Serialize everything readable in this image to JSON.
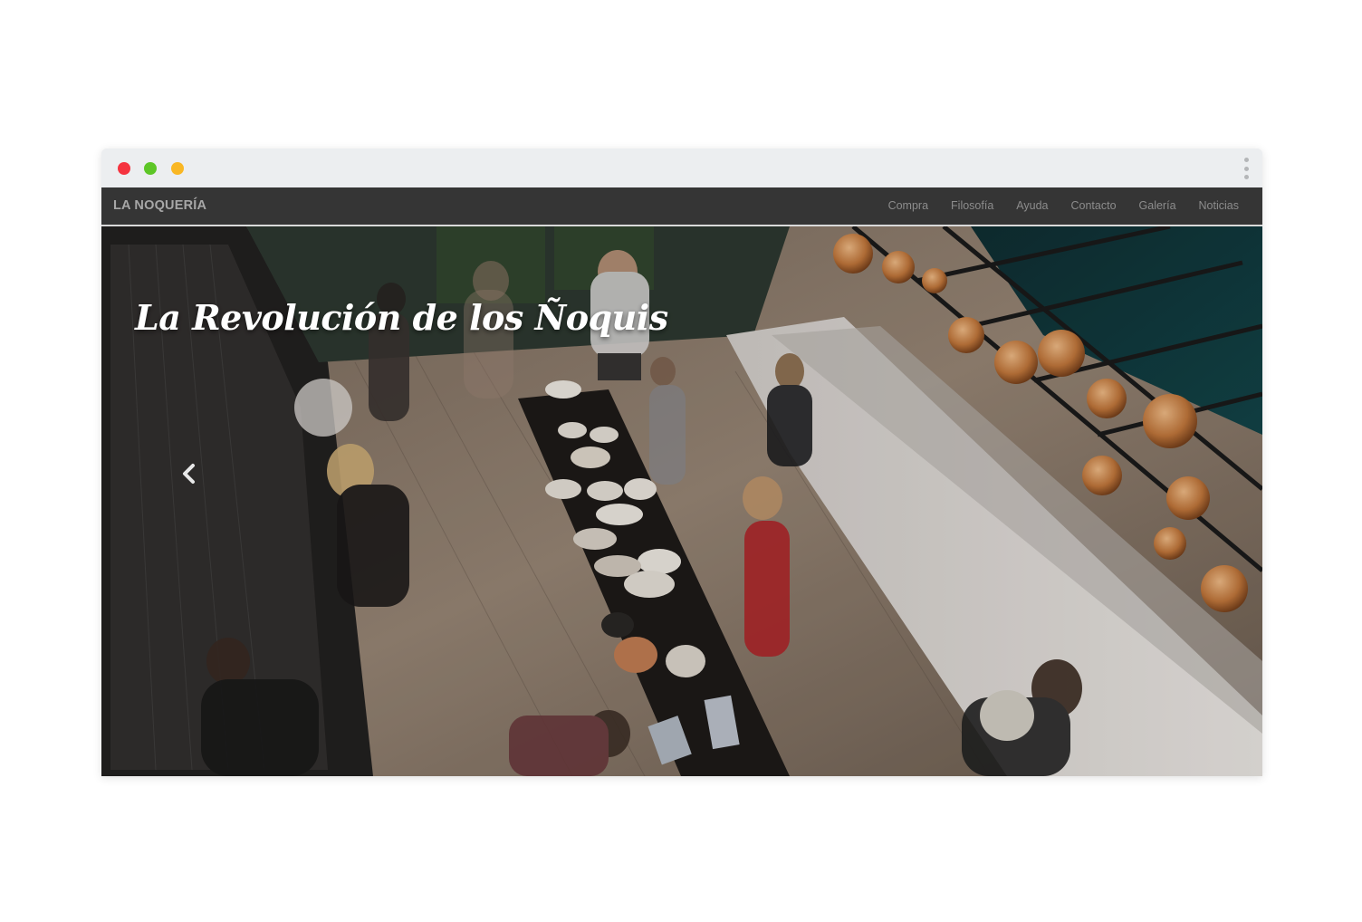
{
  "window": {
    "controls": [
      "close",
      "minimize",
      "maximize"
    ],
    "menu_icon": "kebab-menu-icon"
  },
  "navbar": {
    "brand": "LA NOQUERÍA",
    "links": [
      "Compra",
      "Filosofía",
      "Ayuda",
      "Contacto",
      "Galería",
      "Noticias"
    ]
  },
  "hero": {
    "title": "La Revolución de los Ñoquis",
    "image": "restaurant-interior-buffet-photo",
    "prev_icon": "chevron-left-icon"
  },
  "colors": {
    "navbar_bg": "#353535",
    "chrome_bg": "#eceef0",
    "close": "#f5333f",
    "minimize": "#5dc627",
    "maximize": "#f9b724"
  }
}
